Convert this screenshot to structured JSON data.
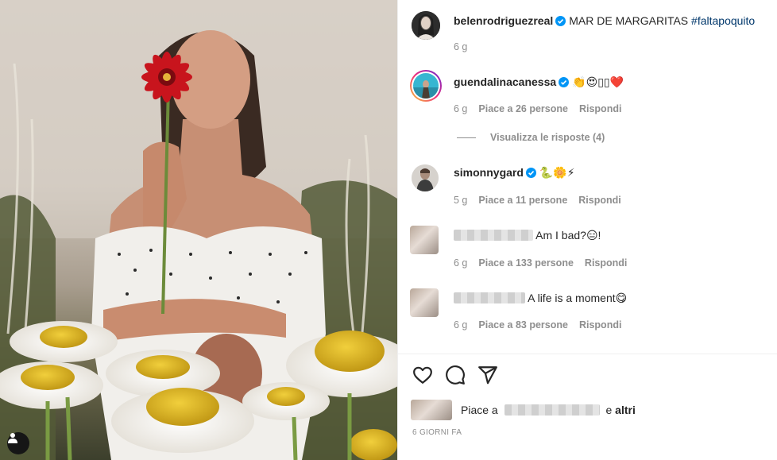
{
  "post": {
    "photo_alt": "",
    "author": {
      "username": "belenrodriguezreal",
      "verified": true,
      "caption": "MAR DE MARGARITAS",
      "hashtag": "#faltapoquito",
      "age": "6 g"
    }
  },
  "comments": [
    {
      "username": "guendalinacanessa",
      "verified": true,
      "text": "👏😍▯▯❤️",
      "age": "6 g",
      "likes": "Piace a 26 persone",
      "reply_label": "Rispondi",
      "view_replies": "Visualizza le risposte (4)"
    },
    {
      "username": "simonnygard",
      "verified": true,
      "text": "🐍🌼⚡",
      "age": "5 g",
      "likes": "Piace a 11 persone",
      "reply_label": "Rispondi"
    },
    {
      "username_hidden": true,
      "text": "Am I bad?😑!",
      "age": "6 g",
      "likes": "Piace a 133 persone",
      "reply_label": "Rispondi"
    },
    {
      "username_hidden": true,
      "text": "A life is a moment😋",
      "age": "6 g",
      "likes": "Piace a 83 persone",
      "reply_label": "Rispondi"
    }
  ],
  "actions": {
    "like_icon": "heart-icon",
    "comment_icon": "comment-icon",
    "share_icon": "paper-plane-icon"
  },
  "likes_summary": {
    "prefix": "Piace a",
    "connector": "e",
    "others": "altri"
  },
  "timestamp": "6 GIORNI FA",
  "colors": {
    "verified_blue": "#0095f6",
    "hashtag": "#00376b",
    "muted": "#8e8e8e"
  }
}
